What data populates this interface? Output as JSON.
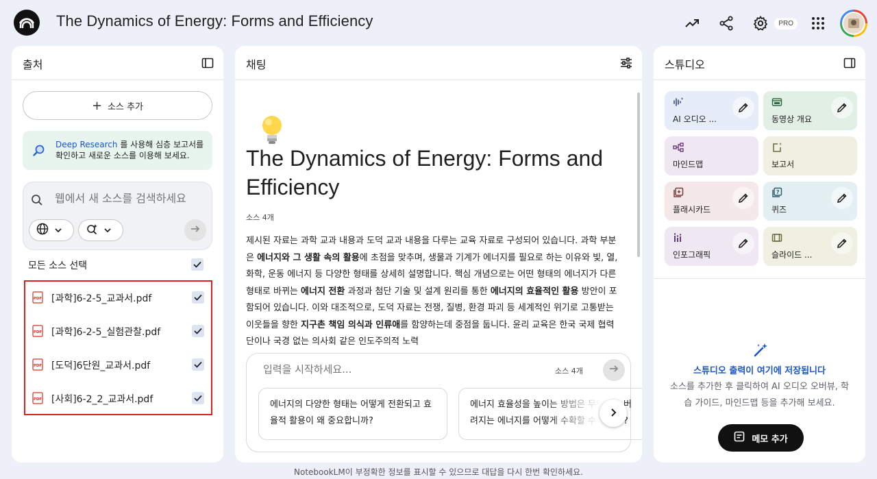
{
  "header": {
    "title": "The Dynamics of Energy: Forms and Efficiency",
    "pro_badge": "PRO"
  },
  "sources": {
    "title": "출처",
    "add_label": "소스 추가",
    "deep_research_link": "Deep Research",
    "deep_research_text": "를 사용해 심층 보고서를 확인하고 새로운 소스를 이용해 보세요.",
    "search_placeholder": "웹에서 새 소스를 검색하세요",
    "select_all_label": "모든 소스 선택",
    "items": [
      {
        "name": "[과학]6-2-5_교과서.pdf",
        "checked": true
      },
      {
        "name": "[과학]6-2-5_실험관찰.pdf",
        "checked": true
      },
      {
        "name": "[도덕]6단원_교과서.pdf",
        "checked": true
      },
      {
        "name": "[사회]6-2_2_교과서.pdf",
        "checked": true
      }
    ]
  },
  "chat": {
    "title": "채팅",
    "heading": "The Dynamics of Energy: Forms and Efficiency",
    "source_count": "소스 4개",
    "summary_parts": [
      {
        "t": "제시된 자료는 과학 교과 내용과 도덕 교과 내용을 다루는 교육 자료로 구성되어 있습니다. 과학 부분은 ",
        "b": false
      },
      {
        "t": "에너지와 그 생활 속의 활용",
        "b": true
      },
      {
        "t": "에 초점을 맞추며, 생물과 기계가 에너지를 필요로 하는 이유와 빛, 열, 화학, 운동 에너지 등 다양한 형태를 상세히 설명합니다. 핵심 개념으로는 어떤 형태의 에너지가 다른 형태로 바뀌는 ",
        "b": false
      },
      {
        "t": "에너지 전환",
        "b": true
      },
      {
        "t": " 과정과 첨단 기술 및 설계 원리를 통한 ",
        "b": false
      },
      {
        "t": "에너지의 효율적인 활용",
        "b": true
      },
      {
        "t": " 방안이 포함되어 있습니다. 이와 대조적으로, 도덕 자료는 전쟁, 질병, 환경 파괴 등 세계적인 위기로 고통받는 이웃들을 향한 ",
        "b": false
      },
      {
        "t": "지구촌 책임 의식과 인류애",
        "b": true
      },
      {
        "t": "를 함양하는데 중점을 둡니다. 윤리 교육은 한국 국제 협력단이나 국경 없는 의사회 같은 인도주의적 노력",
        "b": false
      }
    ],
    "input_placeholder": "입력을 시작하세요...",
    "input_source_count": "소스 4개",
    "suggestions": [
      "에너지의 다양한 형태는 어떻게 전환되고 효율적 활용이 왜 중요합니까?",
      "에너지 효율성을 높이는 방법은 무엇이며 버려지는 에너지를 어떻게 수확할 수 있나요?"
    ]
  },
  "studio": {
    "title": "스튜디오",
    "tiles": [
      {
        "label": "AI 오디오 ...",
        "icon": "audio-wave-icon",
        "bg": "#e6ecf8",
        "color": "#3b4a7a",
        "edit": true
      },
      {
        "label": "동영상 개요",
        "icon": "video-icon",
        "bg": "#e2efe5",
        "color": "#2e6b45",
        "edit": true
      },
      {
        "label": "마인드맵",
        "icon": "mindmap-icon",
        "bg": "#efe8f2",
        "color": "#6a3b7a",
        "edit": false
      },
      {
        "label": "보고서",
        "icon": "report-icon",
        "bg": "#efefe2",
        "color": "#6b6a3b",
        "edit": false
      },
      {
        "label": "플래시카드",
        "icon": "flashcard-icon",
        "bg": "#f4e8e8",
        "color": "#7a3b3b",
        "edit": true
      },
      {
        "label": "퀴즈",
        "icon": "quiz-icon",
        "bg": "#e4eff3",
        "color": "#2e5d6b",
        "edit": true
      },
      {
        "label": "인포그래픽",
        "icon": "infographic-icon",
        "bg": "#efe8f2",
        "color": "#5a3b7a",
        "edit": true
      },
      {
        "label": "슬라이드 ...",
        "icon": "slides-icon",
        "bg": "#efefe2",
        "color": "#6b6a3b",
        "edit": true
      }
    ],
    "empty_title": "스튜디오 출력이 여기에 저장됩니다",
    "empty_desc": "소스를 추가한 후 클릭하여 AI 오디오 오버뷰, 학습 가이드, 마인드맵 등을 추가해 보세요.",
    "memo_label": "메모 추가"
  },
  "footer": {
    "notice": "NotebookLM이 부정확한 정보를 표시할 수 있으므로 대답을 다시 한번 확인하세요."
  }
}
